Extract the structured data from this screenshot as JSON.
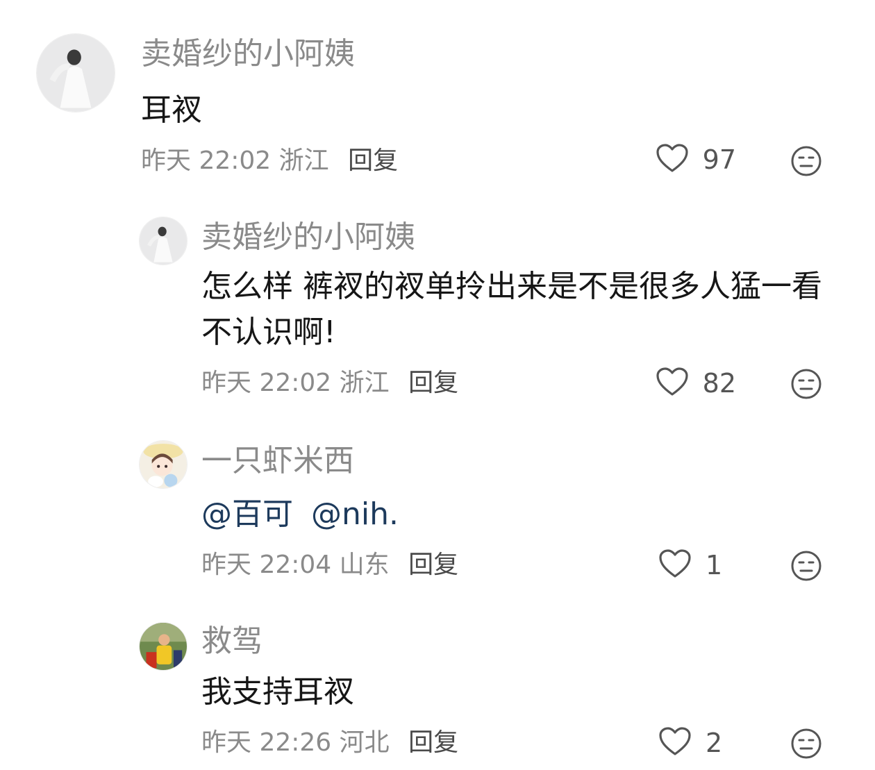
{
  "comments": [
    {
      "username": "卖婚纱的小阿姨",
      "text": "耳衩",
      "time": "昨天 22:02",
      "location": "浙江",
      "reply_label": "回复",
      "likes": "97"
    },
    {
      "username": "卖婚纱的小阿姨",
      "text": "怎么样 裤衩的衩单拎出来是不是很多人猛一看不认识啊!",
      "time": "昨天 22:02",
      "location": "浙江",
      "reply_label": "回复",
      "likes": "82"
    },
    {
      "username": "一只虾米西",
      "mentions": [
        "@百可",
        "@nih."
      ],
      "time": "昨天 22:04",
      "location": "山东",
      "reply_label": "回复",
      "likes": "1"
    },
    {
      "username": "救驾",
      "text": "我支持耳衩",
      "time": "昨天 22:26",
      "location": "河北",
      "reply_label": "回复",
      "likes": "2"
    }
  ],
  "icons": {
    "like": "heart-outline-icon",
    "dislike": "unamused-face-icon"
  },
  "colors": {
    "username": "#8a8a8a",
    "mention": "#1d3a5c",
    "text": "#161616"
  }
}
